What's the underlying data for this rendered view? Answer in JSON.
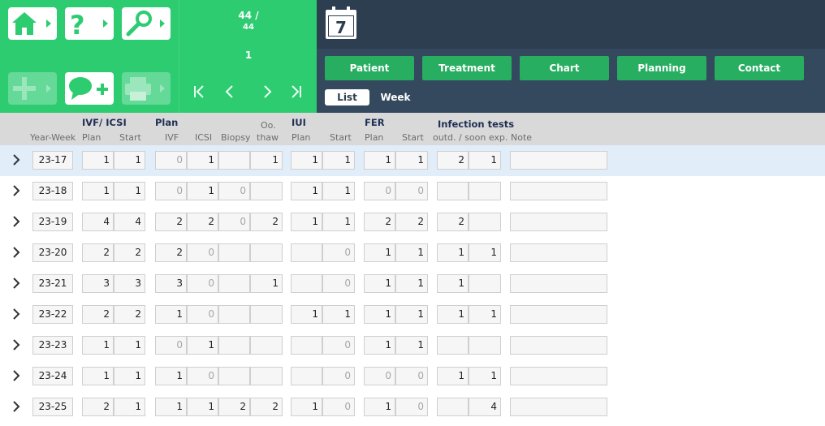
{
  "toolbar": {
    "buttons": [
      {
        "name": "home",
        "icon": "home-icon"
      },
      {
        "name": "help",
        "icon": "question-icon"
      },
      {
        "name": "search",
        "icon": "search-icon"
      },
      {
        "name": "add",
        "icon": "plus-icon",
        "disabled": true
      },
      {
        "name": "comment",
        "icon": "comment-add-icon"
      },
      {
        "name": "print",
        "icon": "printer-icon",
        "disabled": true
      }
    ]
  },
  "pager": {
    "total_line1": "44 /",
    "total_line2": "44",
    "current": "1",
    "first": "|‹",
    "prev": "‹",
    "next": "›",
    "last": "›|"
  },
  "calendar": {
    "day": "7"
  },
  "tabs": [
    {
      "label": "Patient"
    },
    {
      "label": "Treatment"
    },
    {
      "label": "Chart"
    },
    {
      "label": "Planning"
    },
    {
      "label": "Contact"
    }
  ],
  "views": {
    "list": "List",
    "week": "Week",
    "active": "List"
  },
  "headers": {
    "year_week": "Year-Week",
    "ivf_icsi": "IVF/ ICSI",
    "ivf_icsi_plan": "Plan",
    "ivf_icsi_start": "Start",
    "plan": "Plan",
    "plan_ivf": "IVF",
    "plan_icsi": "ICSI",
    "plan_biopsy": "Biopsy",
    "plan_oo_thaw_1": "Oo.",
    "plan_oo_thaw_2": "thaw",
    "iui": "IUI",
    "iui_plan": "Plan",
    "iui_start": "Start",
    "fer": "FER",
    "fer_plan": "Plan",
    "fer_start": "Start",
    "infection": "Infection tests",
    "infection_sub": "outd. / soon exp.",
    "note": "Note"
  },
  "rows": [
    {
      "week": "23-17",
      "ivf_plan": "1",
      "ivf_start": "1",
      "p_ivf": "0",
      "p_icsi": "1",
      "p_biopsy": "",
      "p_oo": "1",
      "iui_plan": "1",
      "iui_start": "1",
      "fer_plan": "1",
      "fer_start": "1",
      "inf_outd": "2",
      "inf_soon": "1",
      "note": ""
    },
    {
      "week": "23-18",
      "ivf_plan": "1",
      "ivf_start": "1",
      "p_ivf": "0",
      "p_icsi": "1",
      "p_biopsy": "0",
      "p_oo": "",
      "iui_plan": "1",
      "iui_start": "1",
      "fer_plan": "0",
      "fer_start": "0",
      "inf_outd": "",
      "inf_soon": "",
      "note": ""
    },
    {
      "week": "23-19",
      "ivf_plan": "4",
      "ivf_start": "4",
      "p_ivf": "2",
      "p_icsi": "2",
      "p_biopsy": "0",
      "p_oo": "2",
      "iui_plan": "1",
      "iui_start": "1",
      "fer_plan": "2",
      "fer_start": "2",
      "inf_outd": "2",
      "inf_soon": "",
      "note": ""
    },
    {
      "week": "23-20",
      "ivf_plan": "2",
      "ivf_start": "2",
      "p_ivf": "2",
      "p_icsi": "0",
      "p_biopsy": "",
      "p_oo": "",
      "iui_plan": "",
      "iui_start": "0",
      "fer_plan": "1",
      "fer_start": "1",
      "inf_outd": "1",
      "inf_soon": "1",
      "note": ""
    },
    {
      "week": "23-21",
      "ivf_plan": "3",
      "ivf_start": "3",
      "p_ivf": "3",
      "p_icsi": "0",
      "p_biopsy": "",
      "p_oo": "1",
      "iui_plan": "",
      "iui_start": "0",
      "fer_plan": "1",
      "fer_start": "1",
      "inf_outd": "1",
      "inf_soon": "",
      "note": ""
    },
    {
      "week": "23-22",
      "ivf_plan": "2",
      "ivf_start": "2",
      "p_ivf": "1",
      "p_icsi": "0",
      "p_biopsy": "",
      "p_oo": "",
      "iui_plan": "1",
      "iui_start": "1",
      "fer_plan": "1",
      "fer_start": "1",
      "inf_outd": "1",
      "inf_soon": "1",
      "note": ""
    },
    {
      "week": "23-23",
      "ivf_plan": "1",
      "ivf_start": "1",
      "p_ivf": "0",
      "p_icsi": "1",
      "p_biopsy": "",
      "p_oo": "",
      "iui_plan": "",
      "iui_start": "0",
      "fer_plan": "1",
      "fer_start": "1",
      "inf_outd": "",
      "inf_soon": "",
      "note": ""
    },
    {
      "week": "23-24",
      "ivf_plan": "1",
      "ivf_start": "1",
      "p_ivf": "1",
      "p_icsi": "0",
      "p_biopsy": "",
      "p_oo": "",
      "iui_plan": "",
      "iui_start": "0",
      "fer_plan": "0",
      "fer_start": "0",
      "inf_outd": "1",
      "inf_soon": "1",
      "note": ""
    },
    {
      "week": "23-25",
      "ivf_plan": "2",
      "ivf_start": "1",
      "p_ivf": "1",
      "p_icsi": "1",
      "p_biopsy": "2",
      "p_oo": "2",
      "iui_plan": "1",
      "iui_start": "0",
      "fer_plan": "1",
      "fer_start": "0",
      "inf_outd": "",
      "inf_soon": "4",
      "note": ""
    }
  ],
  "colors": {
    "green": "#2ecc71",
    "dark_green": "#27ae60",
    "navy": "#2c3e50",
    "selected_row": "#e1edf9"
  }
}
